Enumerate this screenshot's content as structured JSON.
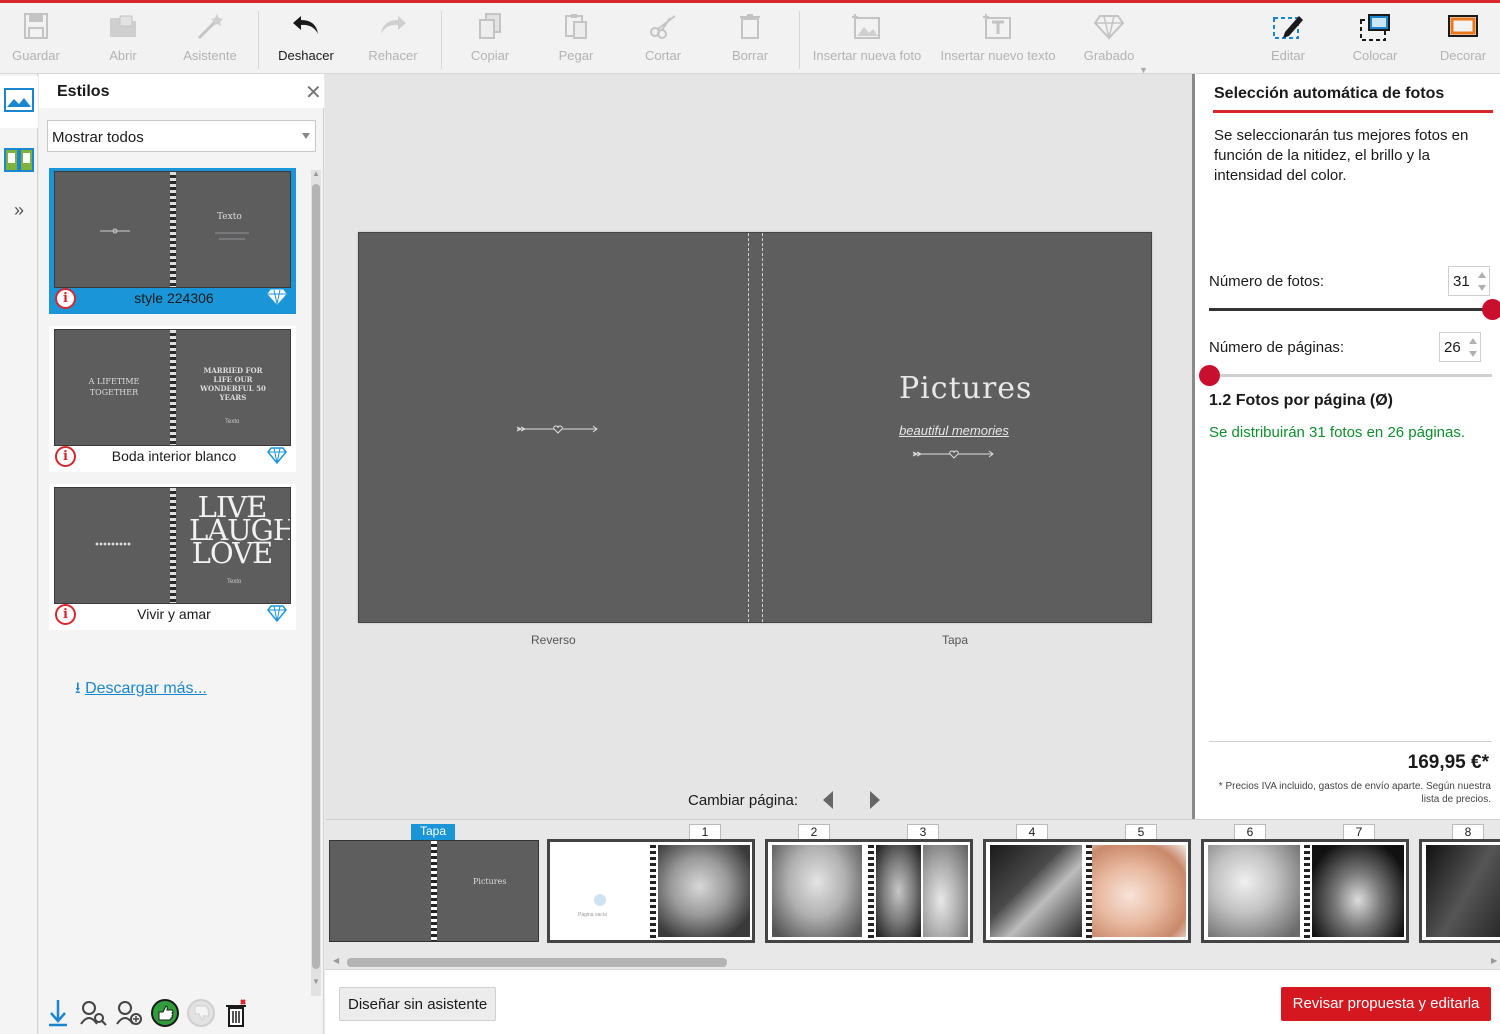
{
  "toolbar": {
    "items": [
      {
        "label": "Guardar",
        "icon": "save-icon"
      },
      {
        "label": "Abrir",
        "icon": "open-icon"
      },
      {
        "label": "Asistente",
        "icon": "wand-icon"
      },
      {
        "label": "Deshacer",
        "icon": "undo-icon"
      },
      {
        "label": "Rehacer",
        "icon": "redo-icon"
      },
      {
        "label": "Copiar",
        "icon": "copy-icon"
      },
      {
        "label": "Pegar",
        "icon": "paste-icon"
      },
      {
        "label": "Cortar",
        "icon": "cut-icon"
      },
      {
        "label": "Borrar",
        "icon": "trash-icon"
      },
      {
        "label": "Insertar nueva foto",
        "icon": "insert-photo-icon"
      },
      {
        "label": "Insertar nuevo texto",
        "icon": "insert-text-icon"
      },
      {
        "label": "Grabado",
        "icon": "engrave-icon"
      },
      {
        "label": "Editar",
        "icon": "edit-icon"
      },
      {
        "label": "Colocar",
        "icon": "place-icon"
      },
      {
        "label": "Decorar",
        "icon": "decorate-icon"
      }
    ]
  },
  "styles_panel": {
    "title": "Estilos",
    "filter_value": "Mostrar todos",
    "styles": [
      {
        "name": "style 224306",
        "selected": true,
        "thumb_text": "Texto"
      },
      {
        "name": "Boda interior blanco",
        "selected": false,
        "thumb_left": "A LIFETIME TOGETHER",
        "thumb_right": "MARRIED FOR LIFE OUR WONDERFUL 50 YEARS",
        "thumb_small": "Texto"
      },
      {
        "name": "Vivir y amar",
        "selected": false,
        "thumb_big": "LIVE LAUGH LOVE",
        "thumb_small": "Texto"
      }
    ],
    "download_more": "Descargar más..."
  },
  "canvas": {
    "cover_title": "Pictures",
    "cover_subtitle": "beautiful memories",
    "back_label": "Reverso",
    "front_label": "Tapa",
    "nav_label": "Cambiar página:"
  },
  "auto_select": {
    "title": "Selección automática de fotos",
    "description": "Se seleccionarán tus mejores fotos en función de la nitidez, el brillo y la intensidad del color.",
    "photos_label": "Número de fotos:",
    "photos_value": "31",
    "photos_slider_fraction": 1.0,
    "pages_label": "Número de páginas:",
    "pages_value": "26",
    "pages_slider_fraction": 0.0,
    "ratio": "1.2 Fotos por página (Ø)",
    "distribution": "Se distribuirán 31 fotos en 26 páginas.",
    "price": "169,95 €*",
    "price_note": "* Precios IVA incluido, gastos de envío aparte. Según nuestra lista de precios."
  },
  "thumbnails": {
    "cover_label": "Tapa",
    "page_numbers": [
      "1",
      "2",
      "3",
      "4",
      "5",
      "6",
      "7",
      "8"
    ],
    "page1_placeholder": "Página vacía"
  },
  "bottom": {
    "design_button": "Diseñar sin asistente",
    "review_button": "Revisar propuesta y editarla"
  },
  "colors": {
    "accent_red": "#d5171f",
    "selection_blue": "#1a96d8",
    "success_green": "#0f8f2e",
    "cover_gray": "#5e5e5f"
  }
}
